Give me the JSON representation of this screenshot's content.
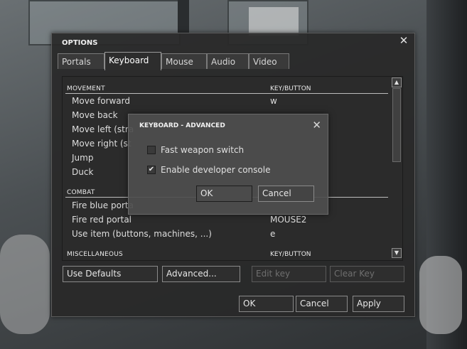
{
  "options": {
    "title": "OPTIONS",
    "close_glyph": "✕",
    "tabs": [
      {
        "label": "Portals"
      },
      {
        "label": "Keyboard"
      },
      {
        "label": "Mouse"
      },
      {
        "label": "Audio"
      },
      {
        "label": "Video"
      }
    ],
    "active_tab": "Keyboard",
    "bindings": {
      "movement": {
        "header": "MOVEMENT",
        "key_header": "KEY/BUTTON",
        "rows": [
          {
            "action": "Move forward",
            "key": "w"
          },
          {
            "action": "Move back",
            "key": ""
          },
          {
            "action": "Move left (stra",
            "key": ""
          },
          {
            "action": "Move right (st",
            "key": ""
          },
          {
            "action": "Jump",
            "key": ""
          },
          {
            "action": "Duck",
            "key": ""
          }
        ]
      },
      "combat": {
        "header": "COMBAT",
        "rows": [
          {
            "action": "Fire blue porta",
            "key": ""
          },
          {
            "action": "Fire red portal",
            "key": "MOUSE2"
          },
          {
            "action": "Use item (buttons, machines, ...)",
            "key": "e"
          }
        ]
      },
      "misc": {
        "header": "MISCELLANEOUS",
        "key_header": "KEY/BUTTON"
      }
    },
    "buttons": {
      "use_defaults": "Use Defaults",
      "advanced": "Advanced...",
      "edit_key": "Edit key",
      "clear_key": "Clear Key",
      "ok": "OK",
      "cancel": "Cancel",
      "apply": "Apply"
    },
    "scroll_up_glyph": "▲",
    "scroll_down_glyph": "▼"
  },
  "advanced_dialog": {
    "title": "KEYBOARD - ADVANCED",
    "close_glyph": "✕",
    "checkboxes": [
      {
        "label": "Fast weapon switch",
        "checked": false,
        "mark": ""
      },
      {
        "label": "Enable developer console",
        "checked": true,
        "mark": "✔"
      }
    ],
    "ok": "OK",
    "cancel": "Cancel"
  }
}
